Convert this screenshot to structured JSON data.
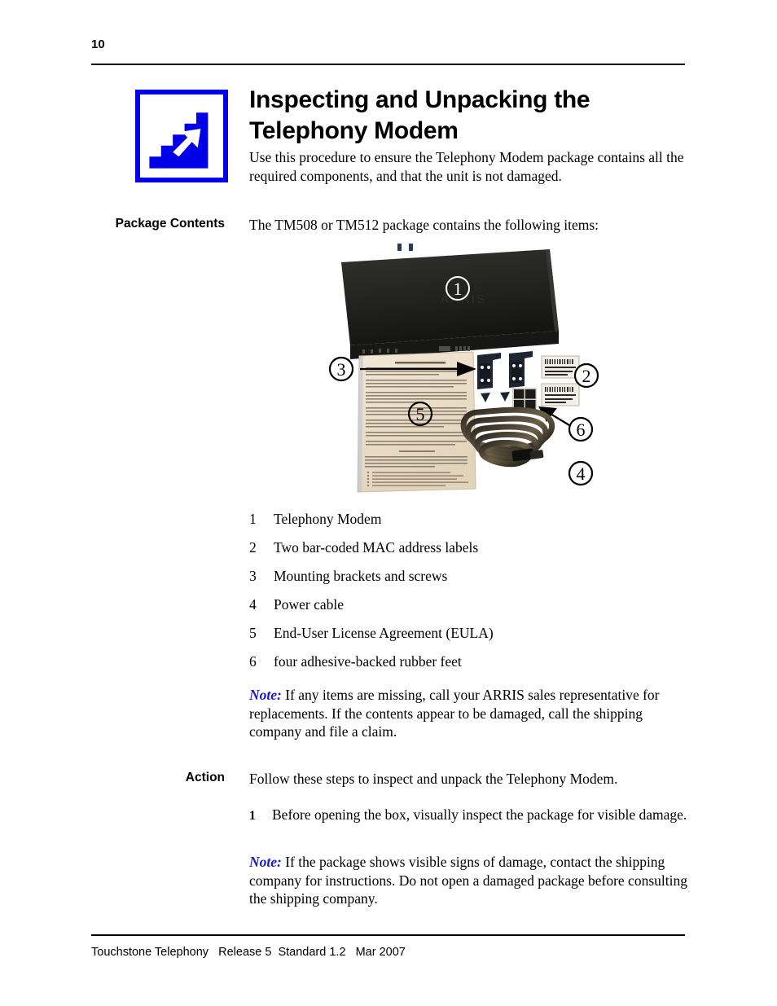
{
  "header": {
    "page_number": "10"
  },
  "chapter": {
    "icon": "stairs-up-arrow-icon",
    "icon_color": "#0000e8",
    "title_line1": "Inspecting and Unpacking the",
    "title_line2": "Telephony Modem",
    "intro": "Use this procedure to ensure the Telephony Modem package contains all the required components, and that the unit is not damaged."
  },
  "package_contents": {
    "heading": "Package Contents",
    "intro": "The TM508 or TM512 package contains the following items:",
    "figure": {
      "name": "telephony-modem-package-contents-photo",
      "callouts": [
        {
          "number": "①",
          "label": "Telephony Modem"
        },
        {
          "number": "②",
          "label": "Two bar-coded MAC address labels"
        },
        {
          "number": "③",
          "label": "Mounting brackets and screws"
        },
        {
          "number": "④",
          "label": "Power cable"
        },
        {
          "number": "⑤",
          "label": "End-User License Agreement (EULA)"
        },
        {
          "number": "⑥",
          "label": "four adhesive-backed rubber feet"
        }
      ]
    },
    "items": [
      {
        "num": "1",
        "label": "Telephony Modem"
      },
      {
        "num": "2",
        "label": "Two bar-coded MAC address labels"
      },
      {
        "num": "3",
        "label": "Mounting brackets and screws"
      },
      {
        "num": "4",
        "label": "Power cable"
      },
      {
        "num": "5",
        "label": "End-User License Agreement (EULA)"
      },
      {
        "num": "6",
        "label": "four adhesive-backed rubber feet"
      }
    ],
    "note": {
      "lead": "Note:",
      "text": " If any items are missing, call your ARRIS sales representative for replacements. If the contents appear to be damaged, call the shipping company and file a claim.",
      "lead_color": "#1a1ad0"
    }
  },
  "action": {
    "heading": "Action",
    "intro": "Follow these steps to inspect and unpack the Telephony Modem.",
    "steps": [
      {
        "num": "1",
        "text": "Before opening the box, visually inspect the package for visible damage."
      }
    ],
    "note": {
      "lead": "Note:",
      "text": " If the package shows visible signs of damage, contact the shipping company for instructions. Do not open a damaged package before consulting the shipping company.",
      "lead_color": "#1a1ad0"
    }
  },
  "footer": {
    "text": "Touchstone Telephony   Release 5  Standard 1.2   Mar 2007"
  }
}
